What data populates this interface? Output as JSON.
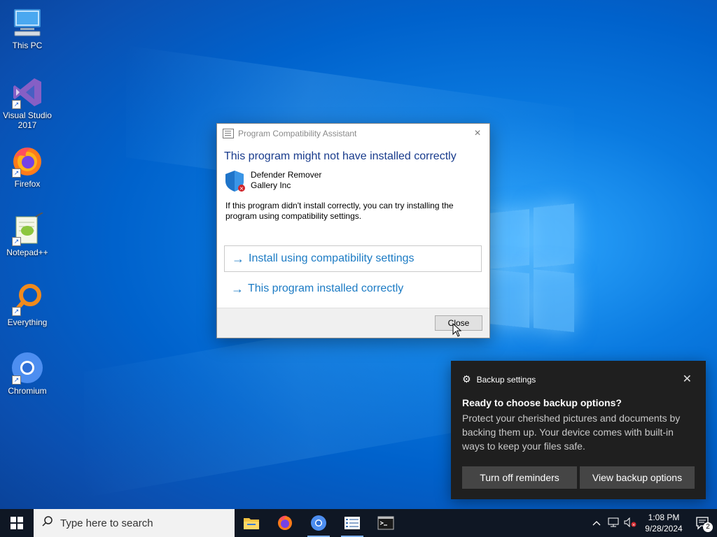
{
  "desktop": {
    "icons": [
      {
        "label": "This PC"
      },
      {
        "label": "Visual Studio 2017"
      },
      {
        "label": "Firefox"
      },
      {
        "label": "Notepad++"
      },
      {
        "label": "Everything"
      },
      {
        "label": "Chromium"
      }
    ]
  },
  "dialog": {
    "title": "Program Compatibility Assistant",
    "heading": "This program might not have installed correctly",
    "program_name": "Defender Remover",
    "publisher": "Gallery Inc",
    "description": "If this program didn't install correctly, you can try installing the program using compatibility settings.",
    "option1": "Install using compatibility settings",
    "option2": "This program installed correctly",
    "close_button": "Close",
    "close_icon": "×",
    "arrow_icon": "→"
  },
  "toast": {
    "app_name": "Backup settings",
    "title": "Ready to choose backup options?",
    "body": "Protect your cherished pictures and documents by backing them up. Your device comes with built-in ways to keep your files safe.",
    "button1": "Turn off reminders",
    "button2": "View backup options",
    "close_icon": "✕",
    "gear_icon": "⚙"
  },
  "taskbar": {
    "search_placeholder": "Type here to search",
    "time": "1:08 PM",
    "date": "9/28/2024",
    "notification_count": "2"
  },
  "colors": {
    "accent": "#0078d7",
    "dialog_link": "#1c7bc4",
    "dialog_heading": "#183b8c",
    "toast_bg": "#1f1f1f",
    "toast_button": "#454545",
    "taskbar": "#0f1724"
  }
}
